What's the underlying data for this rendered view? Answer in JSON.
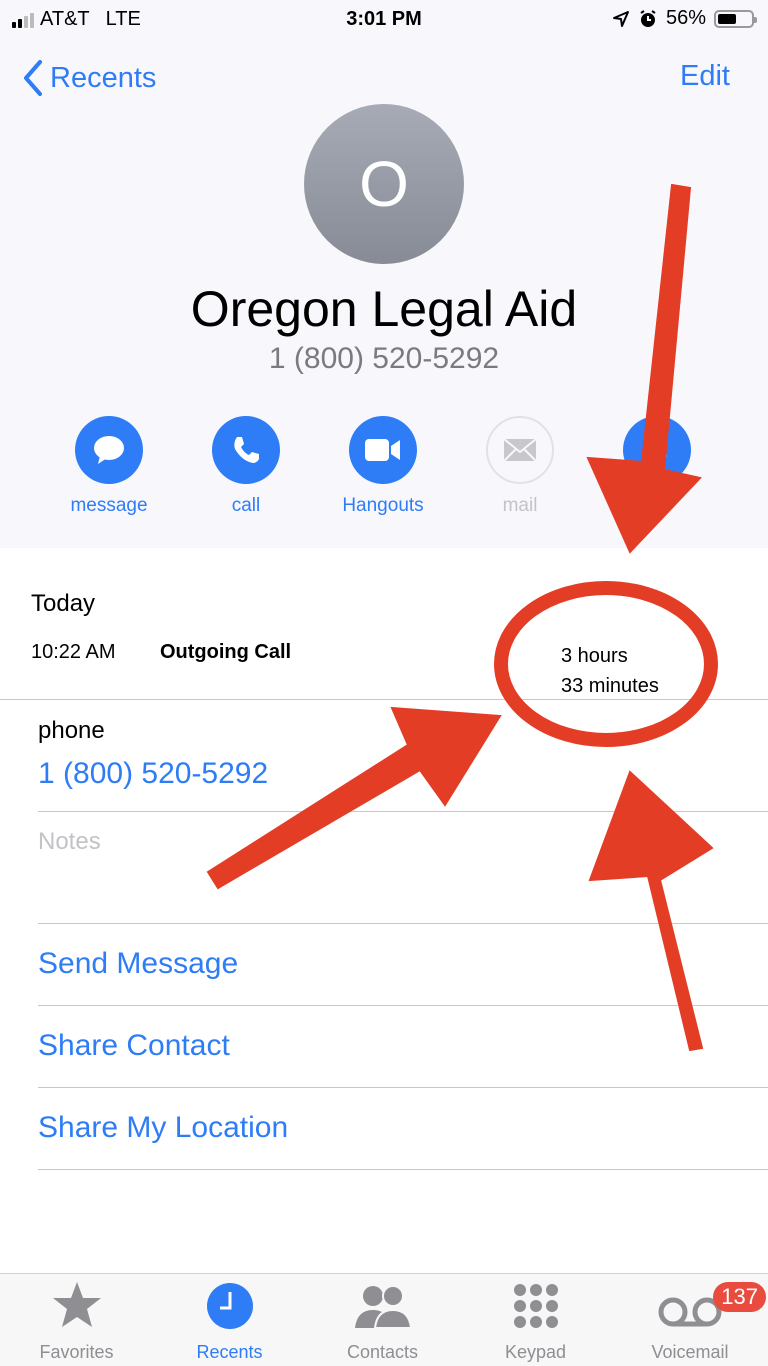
{
  "status_bar": {
    "carrier": "AT&T",
    "network": "LTE",
    "time": "3:01 PM",
    "battery_percent": "56%",
    "battery_level": 0.56,
    "icons": [
      "signal-icon",
      "location-arrow-icon",
      "alarm-icon",
      "battery-icon"
    ]
  },
  "nav": {
    "back_label": "Recents",
    "edit_label": "Edit"
  },
  "contact": {
    "initial": "O",
    "name": "Oregon Legal Aid",
    "phone": "1 (800) 520-5292"
  },
  "actions": [
    {
      "label": "message",
      "icon": "message-bubble-icon",
      "enabled": true
    },
    {
      "label": "call",
      "icon": "phone-icon",
      "enabled": true
    },
    {
      "label": "Hangouts",
      "icon": "video-camera-icon",
      "enabled": true
    },
    {
      "label": "mail",
      "icon": "envelope-icon",
      "enabled": false
    },
    {
      "label": "",
      "icon": "dollar-icon",
      "enabled": true
    }
  ],
  "call_log": {
    "day": "Today",
    "time": "10:22 AM",
    "type": "Outgoing Call",
    "duration_line1": "3 hours",
    "duration_line2": "33 minutes"
  },
  "phone_field": {
    "label": "phone",
    "value": "1 (800) 520-5292"
  },
  "notes": {
    "placeholder": "Notes"
  },
  "links": [
    "Send Message",
    "Share Contact",
    "Share My Location"
  ],
  "tabbar": {
    "tabs": [
      {
        "label": "Favorites",
        "icon": "star-icon",
        "active": false
      },
      {
        "label": "Recents",
        "icon": "clock-icon",
        "active": true
      },
      {
        "label": "Contacts",
        "icon": "contacts-icon",
        "active": false
      },
      {
        "label": "Keypad",
        "icon": "keypad-icon",
        "active": false
      },
      {
        "label": "Voicemail",
        "icon": "voicemail-icon",
        "active": false
      }
    ],
    "voicemail_badge": "137"
  },
  "colors": {
    "accent": "#2e7cf6",
    "annotation": "#e43d26",
    "badge": "#e94b3f"
  }
}
